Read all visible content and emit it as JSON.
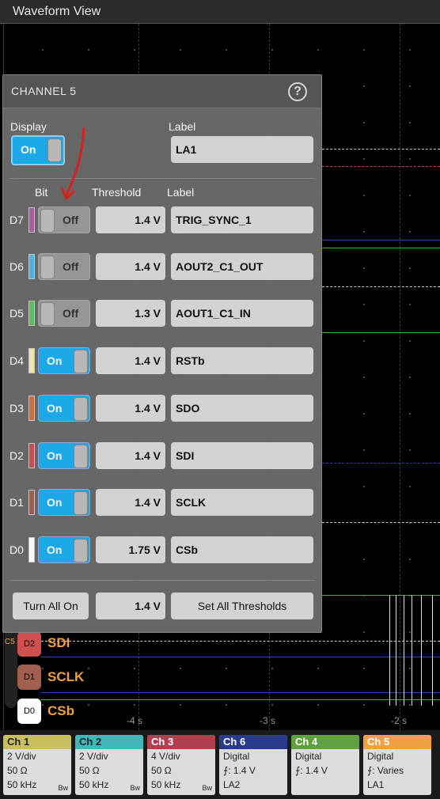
{
  "window": {
    "title": "Waveform View"
  },
  "dialog": {
    "title": "CHANNEL 5",
    "help_glyph": "?",
    "display_label": "Display",
    "display_value": "On",
    "label_heading": "Label",
    "label_value": "LA1",
    "col_bit": "Bit",
    "col_threshold": "Threshold",
    "col_label": "Label",
    "bits": [
      {
        "name": "D7",
        "color": "#b060a0",
        "state": "Off",
        "threshold": "1.4 V",
        "label": "TRIG_SYNC_1"
      },
      {
        "name": "D6",
        "color": "#50b8e8",
        "state": "Off",
        "threshold": "1.4 V",
        "label": "AOUT2_C1_OUT"
      },
      {
        "name": "D5",
        "color": "#60c060",
        "state": "Off",
        "threshold": "1.3 V",
        "label": "AOUT1_C1_IN"
      },
      {
        "name": "D4",
        "color": "#f0f0b0",
        "state": "On",
        "threshold": "1.4 V",
        "label": "RSTb"
      },
      {
        "name": "D3",
        "color": "#d07040",
        "state": "On",
        "threshold": "1.4 V",
        "label": "SDO"
      },
      {
        "name": "D2",
        "color": "#d05050",
        "state": "On",
        "threshold": "1.4 V",
        "label": "SDI"
      },
      {
        "name": "D1",
        "color": "#a06050",
        "state": "On",
        "threshold": "1.4 V",
        "label": "SCLK"
      },
      {
        "name": "D0",
        "color": "#ffffff",
        "state": "On",
        "threshold": "1.75 V",
        "label": "CSb"
      }
    ],
    "turn_all_on": "Turn All On",
    "all_threshold": "1.4 V",
    "set_all_thresholds": "Set All Thresholds"
  },
  "waveform": {
    "visible_labels": [
      {
        "tag": "D2",
        "name": "SDI"
      },
      {
        "tag": "D1",
        "name": "SCLK"
      },
      {
        "tag": "D0",
        "name": "CSb"
      }
    ],
    "rail_marker": "C5",
    "x_ticks": [
      "-4 s",
      "-3 s",
      "-2 s"
    ]
  },
  "channels": [
    {
      "title": "Ch 1",
      "color": "#c8c060",
      "lines": [
        "2 V/div",
        "50 Ω",
        "50 kHz"
      ],
      "bw": "Bw"
    },
    {
      "title": "Ch 2",
      "color": "#40b8b8",
      "lines": [
        "2 V/div",
        "50 Ω",
        "50 kHz"
      ],
      "bw": "Bw"
    },
    {
      "title": "Ch 3",
      "color": "#b04050",
      "lines": [
        "4 V/div",
        "50 Ω",
        "50 kHz"
      ],
      "bw": "Bw"
    },
    {
      "title": "Ch 6",
      "color": "#2a3a8a",
      "lines": [
        "Digital",
        "⨍: 1.4 V",
        "LA2"
      ],
      "bw": ""
    },
    {
      "title": "Ch 4",
      "color": "#60a040",
      "lines": [
        "Digital",
        "⨍: 1.4 V",
        ""
      ],
      "bw": ""
    },
    {
      "title": "Ch 5",
      "color": "#f0a040",
      "lines": [
        "Digital",
        "⨍: Varies",
        "LA1"
      ],
      "bw": ""
    }
  ]
}
